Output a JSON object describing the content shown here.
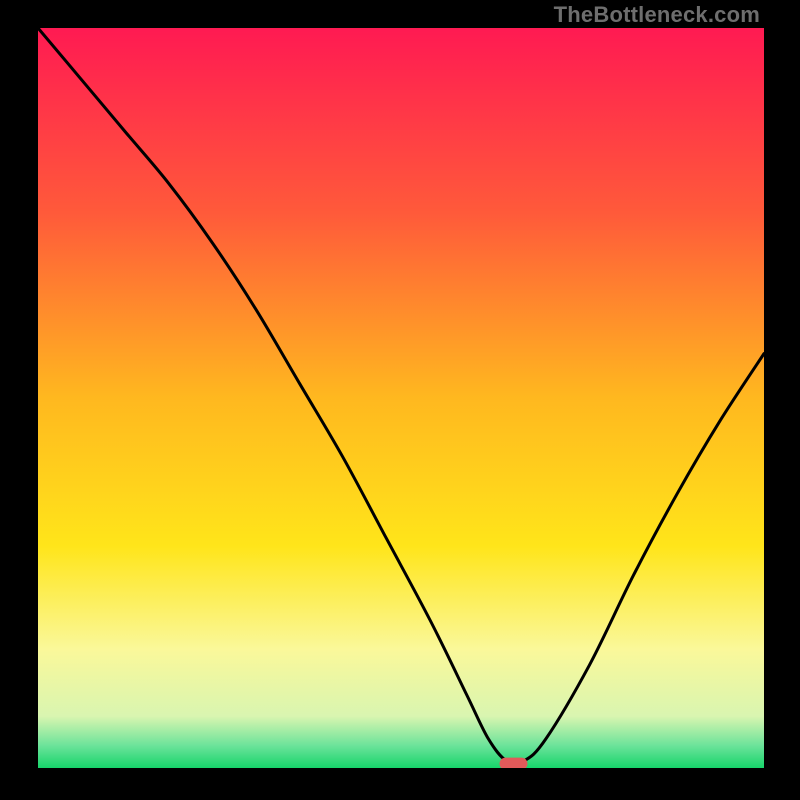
{
  "watermark": "TheBottleneck.com",
  "chart_data": {
    "type": "line",
    "title": "",
    "xlabel": "",
    "ylabel": "",
    "xlim": [
      0,
      100
    ],
    "ylim": [
      0,
      100
    ],
    "grid": false,
    "legend": false,
    "background_gradient": {
      "stops": [
        {
          "pos": 0.0,
          "color": "#ff1a52"
        },
        {
          "pos": 0.25,
          "color": "#ff5a3a"
        },
        {
          "pos": 0.5,
          "color": "#ffb81f"
        },
        {
          "pos": 0.7,
          "color": "#ffe51a"
        },
        {
          "pos": 0.84,
          "color": "#faf89a"
        },
        {
          "pos": 0.93,
          "color": "#d9f5b0"
        },
        {
          "pos": 0.97,
          "color": "#6be39a"
        },
        {
          "pos": 1.0,
          "color": "#17d46a"
        }
      ]
    },
    "series": [
      {
        "name": "bottleneck-curve",
        "color": "#000000",
        "x": [
          0,
          6,
          12,
          18,
          24,
          30,
          36,
          42,
          48,
          54,
          59,
          62,
          64.5,
          67,
          70,
          76,
          82,
          88,
          94,
          100
        ],
        "y": [
          100,
          93,
          86,
          79,
          71,
          62,
          52,
          42,
          31,
          20,
          10,
          4,
          1,
          1,
          4,
          14,
          26,
          37,
          47,
          56
        ]
      }
    ],
    "marker": {
      "name": "optimal-marker",
      "x": 65.5,
      "y": 0.6,
      "color": "#e15a5a",
      "shape": "pill"
    }
  }
}
